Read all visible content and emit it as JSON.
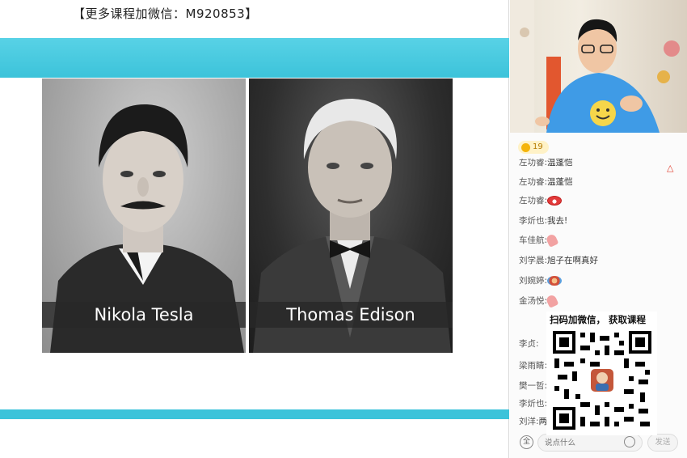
{
  "slide": {
    "banner": "【更多课程加微信：M920853】",
    "portraits": [
      {
        "caption": "Nikola Tesla"
      },
      {
        "caption": "Thomas Edison"
      }
    ]
  },
  "panel": {
    "online_count": "19",
    "chat": [
      {
        "user": "左功睿:",
        "text": "温蓬恺"
      },
      {
        "user": "左功睿:",
        "text": "温蓬恺"
      },
      {
        "user": "左功睿:",
        "emoji": "red-face-sticker"
      },
      {
        "user": "李炘也:",
        "text": "我去!"
      },
      {
        "user": "车佳航:",
        "emoji": "pink-hand-sticker"
      },
      {
        "user": "刘学晨:",
        "text": "旭子在啊真好"
      },
      {
        "user": "刘婉婷:",
        "emoji": "blue-face-sticker"
      },
      {
        "user": "金汤悦:",
        "emoji": "pink-hand-sticker"
      },
      {
        "user": "李贞:",
        "text": ""
      },
      {
        "user": "梁雨睛:",
        "text": ""
      },
      {
        "user": "樊一哲:",
        "text": ""
      },
      {
        "user": "李炘也:",
        "text": ""
      },
      {
        "user": "刘洋:",
        "text": "两"
      }
    ],
    "qr": {
      "title": "扫码加微信， 获取课程"
    },
    "input": {
      "placeholder": "说点什么",
      "send_label": "发送"
    }
  }
}
